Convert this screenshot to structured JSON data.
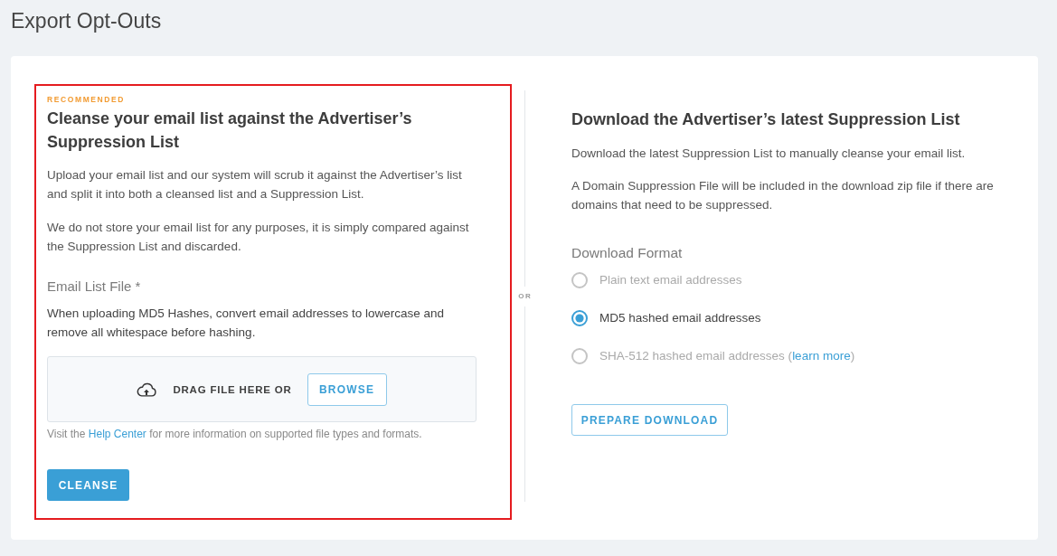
{
  "page_title": "Export Opt-Outs",
  "cleanse_panel": {
    "highlighted": true,
    "badge": "RECOMMENDED",
    "heading": "Cleanse your email list against the Advertiser’s Suppression List",
    "paragraphs": [
      "Upload your email list and our system will scrub it against the Advertiser’s list and split it into both a cleansed list and a Suppression List.",
      "We do not store your email list for any purposes, it is simply compared against the Suppression List and discarded."
    ],
    "field_label": "Email List File *",
    "field_note": "When uploading MD5 Hashes, convert email addresses to lowercase and remove all whitespace before hashing.",
    "dropzone": {
      "prompt": "DRAG FILE HERE OR",
      "browse_button": "BROWSE"
    },
    "help_text": {
      "before": "Visit the ",
      "link": "Help Center",
      "after": " for more information on supported file types and formats."
    },
    "submit_button": "CLEANSE"
  },
  "separator": "OR",
  "download_panel": {
    "heading": "Download the Advertiser’s latest Suppression List",
    "paragraphs": [
      "Download the latest Suppression List to manually cleanse your email list.",
      "A Domain Suppression File will be included in the download zip file if there are domains that need to be suppressed."
    ],
    "format_label": "Download Format",
    "formats": [
      {
        "label": "Plain text email addresses",
        "selected": false,
        "disabled": true
      },
      {
        "label": "MD5 hashed email addresses",
        "selected": true,
        "disabled": false
      },
      {
        "label": "SHA-512 hashed email addresses (",
        "link": "learn more",
        "suffix": ")",
        "selected": false,
        "disabled": true
      }
    ],
    "button": "PREPARE DOWNLOAD"
  }
}
